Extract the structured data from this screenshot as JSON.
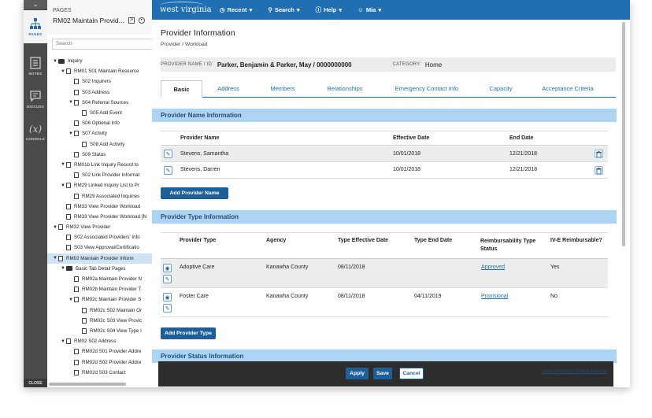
{
  "rail": {
    "items": [
      {
        "label": "PAGES"
      },
      {
        "label": "NOTES"
      },
      {
        "label": "DISCUSS"
      },
      {
        "label": "CONSOLE",
        "glyph": "(x)"
      }
    ],
    "close_label": "CLOSE"
  },
  "pages_panel": {
    "heading": "PAGES",
    "current_page": "RM02 Maintain Provid...",
    "search_placeholder": "Search",
    "tree": [
      {
        "label": "Inquiry",
        "depth": 0,
        "caret": "▼",
        "type": "folder"
      },
      {
        "label": "RM01 S01 Maintain Resource",
        "depth": 1,
        "caret": "▼",
        "type": "doc"
      },
      {
        "label": "S02 Inquirers",
        "depth": 2,
        "caret": "",
        "type": "doc"
      },
      {
        "label": "S03 Address",
        "depth": 2,
        "caret": "",
        "type": "doc"
      },
      {
        "label": "S04 Referral Sources",
        "depth": 2,
        "caret": "▼",
        "type": "doc"
      },
      {
        "label": "S05 Add Event",
        "depth": 3,
        "caret": "",
        "type": "doc"
      },
      {
        "label": "S06 Optional Info",
        "depth": 2,
        "caret": "",
        "type": "doc"
      },
      {
        "label": "S07 Activity",
        "depth": 2,
        "caret": "▼",
        "type": "doc"
      },
      {
        "label": "S08 Add Activity",
        "depth": 3,
        "caret": "",
        "type": "doc"
      },
      {
        "label": "S09 Status",
        "depth": 2,
        "caret": "",
        "type": "doc"
      },
      {
        "label": "RM01b Link Inquiry Record to",
        "depth": 1,
        "caret": "▼",
        "type": "doc"
      },
      {
        "label": "S02 Link Provider Informat",
        "depth": 2,
        "caret": "",
        "type": "doc"
      },
      {
        "label": "RM29 Linked Inquiry List to Pr",
        "depth": 1,
        "caret": "▼",
        "type": "doc"
      },
      {
        "label": "RM29 Associated Inquiries",
        "depth": 2,
        "caret": "",
        "type": "doc"
      },
      {
        "label": "RM33 View Provider Workload",
        "depth": 1,
        "caret": "",
        "type": "doc"
      },
      {
        "label": "RM33 View Provider Workload [N",
        "depth": 1,
        "caret": "",
        "type": "doc"
      },
      {
        "label": "RM32 View Provider",
        "depth": 0,
        "caret": "▼",
        "type": "doc"
      },
      {
        "label": "S02 Associated Providers' Info",
        "depth": 1,
        "caret": "",
        "type": "doc"
      },
      {
        "label": "S03 View Approval/Certificatio",
        "depth": 1,
        "caret": "",
        "type": "doc"
      },
      {
        "label": "RM02 Maintain Provider Inform",
        "depth": 0,
        "caret": "▼",
        "type": "doc",
        "selected": true
      },
      {
        "label": "Basic Tab Detail Pages",
        "depth": 1,
        "caret": "▼",
        "type": "folder"
      },
      {
        "label": "RM02a Maintain Provider N",
        "depth": 2,
        "caret": "",
        "type": "doc"
      },
      {
        "label": "RM02b Maintain Provider T",
        "depth": 2,
        "caret": "",
        "type": "doc"
      },
      {
        "label": "RM02c Maintain Provider S",
        "depth": 2,
        "caret": "▼",
        "type": "doc"
      },
      {
        "label": "RM02c S02 Maintain Or",
        "depth": 3,
        "caret": "",
        "type": "doc"
      },
      {
        "label": "RM02c S03 View Provic",
        "depth": 3,
        "caret": "",
        "type": "doc"
      },
      {
        "label": "RM02c S04 View Type I",
        "depth": 3,
        "caret": "",
        "type": "doc"
      },
      {
        "label": "RM02 S02 Address",
        "depth": 1,
        "caret": "▼",
        "type": "doc"
      },
      {
        "label": "RM02d S01 Provider Addre",
        "depth": 2,
        "caret": "",
        "type": "doc"
      },
      {
        "label": "RM02d S02 Provider Addre",
        "depth": 2,
        "caret": "",
        "type": "doc"
      },
      {
        "label": "RM02d S03 Contact",
        "depth": 2,
        "caret": "",
        "type": "doc"
      }
    ]
  },
  "topbar": {
    "logo": "west virginia",
    "nav": [
      {
        "label": "Recent",
        "icon": "clock-icon"
      },
      {
        "label": "Search",
        "icon": "search-icon"
      },
      {
        "label": "Help",
        "icon": "help-icon"
      },
      {
        "label": "Mia",
        "icon": "user-icon"
      }
    ]
  },
  "page": {
    "title": "Provider Information",
    "breadcrumb": "Provider / Workload",
    "provider_key": "PROVIDER NAME / ID:",
    "provider_value": "Parker, Benjamin & Parker, May / 0000000000",
    "category_key": "CATEGORY:",
    "category_value": "Home",
    "tabs": [
      "Basic",
      "Address",
      "Members",
      "Relationships",
      "Emergency Contact Info",
      "Capacity",
      "Acceptance Criteria"
    ]
  },
  "provider_name": {
    "section_title": "Provider Name Information",
    "headers": [
      "Provider Name",
      "Effective Date",
      "End Date"
    ],
    "rows": [
      {
        "name": "Stevens, Samantha",
        "effective": "10/01/2018",
        "end": "12/21/2018"
      },
      {
        "name": "Stevens, Darren",
        "effective": "10/01/2018",
        "end": "12/21/2018"
      }
    ],
    "add_label": "Add Provider Name"
  },
  "provider_type": {
    "section_title": "Provider Type Information",
    "headers": [
      "Provider Type",
      "Agency",
      "Type Effective Date",
      "Type End Date",
      "Reimbursability Type Status",
      "IV-E Reimbursable?"
    ],
    "rows": [
      {
        "type": "Adoptive Care",
        "agency": "Kanawha County",
        "effective": "08/11/2018",
        "end": "",
        "status": "Approved",
        "ive": "Yes"
      },
      {
        "type": "Foster Care",
        "agency": "Kanawha County",
        "effective": "08/11/2018",
        "end": "04/11/2019",
        "status": "Provisional",
        "ive": "No"
      }
    ],
    "add_label": "Add Provider Type"
  },
  "provider_status": {
    "section_title": "Provider Status Information"
  },
  "footer": {
    "apply": "Apply",
    "save": "Save",
    "cancel": "Cancel",
    "view_history": "View Provider Status History"
  },
  "colors": {
    "brand_blue": "#1f6fb2",
    "section_blue": "#add4f2",
    "button_blue": "#1f5f99"
  }
}
